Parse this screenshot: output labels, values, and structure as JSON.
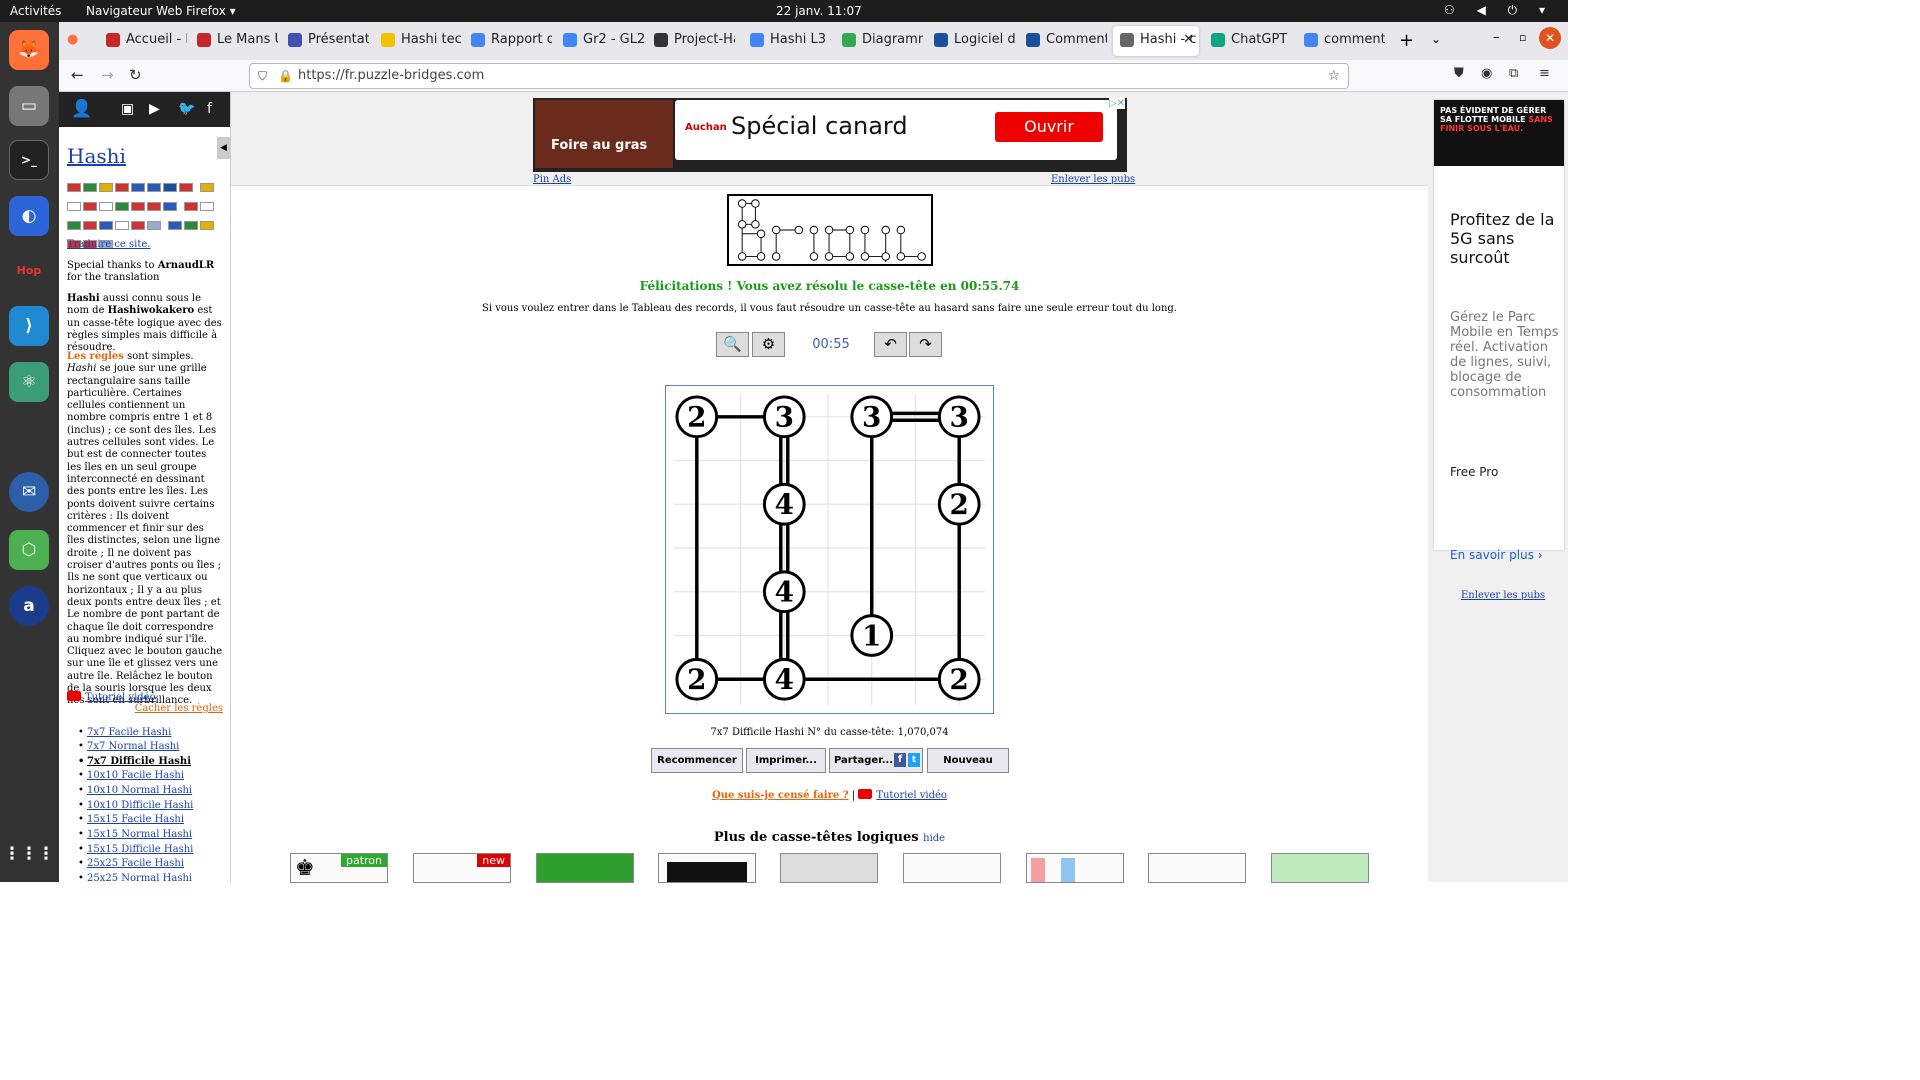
{
  "topbar": {
    "activities": "Activités",
    "app": "Navigateur Web Firefox ▾",
    "clock": "22 janv.  11:07"
  },
  "tabs": [
    {
      "label": "Accueil - E",
      "color": "#c62828"
    },
    {
      "label": "Le Mans U",
      "color": "#c62828"
    },
    {
      "label": "Présentat",
      "color": "#3f51b5"
    },
    {
      "label": "Hashi tech",
      "color": "#f2c200"
    },
    {
      "label": "Rapport d",
      "color": "#4285f4"
    },
    {
      "label": "Gr2 - GL2",
      "color": "#4285f4"
    },
    {
      "label": "Project-Ha",
      "color": "#333333"
    },
    {
      "label": "Hashi L3 -",
      "color": "#4285f4"
    },
    {
      "label": "Diagramm",
      "color": "#34a853"
    },
    {
      "label": "Logiciel de",
      "color": "#1a4fa0"
    },
    {
      "label": "Comment",
      "color": "#1a4fa0"
    },
    {
      "label": "Hashi - c",
      "color": "#666666"
    },
    {
      "label": "ChatGPT",
      "color": "#10a37f"
    },
    {
      "label": "comment",
      "color": "#4285f4"
    }
  ],
  "nav": {
    "url": "https://fr.puzzle-bridges.com"
  },
  "left": {
    "title": "Hashi",
    "translate": "Traduire ce site.",
    "thanks_a": "Special thanks to ",
    "thanks_name": "ArnaudLR",
    "thanks_b": " for the translation",
    "intro_name": "Hashi",
    "intro_a": " aussi connu sous le nom de ",
    "intro_alt": "Hashiwokakero",
    "intro_b": " est un casse-tête logique avec des règles simples mais difficile à résoudre.",
    "rules_label": "Les règles",
    "rules_a": " sont simples. ",
    "rules_name": "Hashi",
    "rules_text": " se joue sur une grille rectangulaire sans taille particulière. Certaines cellules contiennent un nombre compris entre 1 et 8 (inclus) ; ce sont des îles. Les autres cellules sont vides. Le but est de connecter toutes les îles en un seul groupe interconnecté en dessinant des ponts entre les îles. Les ponts doivent suivre certains critères : Ils doivent commencer et finir sur des îles distinctes, selon une ligne droite ; Il ne doivent pas croiser d'autres ponts ou îles ; Ils ne sont que verticaux ou horizontaux ; Il y a au plus deux ponts entre deux îles ; et Le nombre de pont partant de chaque île doit correspondre au nombre indiqué sur l'île.",
    "rules_mouse": "Cliquez avec le bouton gauche sur une île et glissez vers une autre île. Relâchez le bouton de la souris lorsque les deux îles sont en surbrillance.",
    "tutorial": "Tutoriel vidéo",
    "hide_rules": "Cacher les règles",
    "links": [
      "7x7 Facile Hashi",
      "7x7 Normal Hashi",
      "7x7 Difficile Hashi",
      "10x10 Facile Hashi",
      "10x10 Normal Hashi",
      "10x10 Difficile Hashi",
      "15x15 Facile Hashi",
      "15x15 Normal Hashi",
      "15x15 Difficile Hashi",
      "25x25 Facile Hashi",
      "25x25 Normal Hashi"
    ]
  },
  "ad": {
    "img_text": "Foire au gras",
    "brand": "Auchan",
    "headline": "Spécial canard",
    "cta": "Ouvrir",
    "pin": "Pin Ads",
    "remove": "Enlever les pubs"
  },
  "main": {
    "congrats": "Félicitations ! Vous avez résolu le casse-tête en 00:55.74",
    "note": "Si vous voulez entrer dans le Tableau des records, il vous faut résoudre un casse-tête au hasard sans faire une seule erreur tout du long.",
    "timer": "00:55",
    "puzzle_info": "7x7 Difficile Hashi N° du casse-tête: 1,070,074",
    "buttons": [
      "Recommencer",
      "Imprimer...",
      "Partager...",
      "Nouveau"
    ],
    "help_what": "Que suis-je censé faire ?",
    "help_sep": " | ",
    "help_tutorial": "Tutoriel vidéo",
    "more_title": "Plus de casse-têtes logiques",
    "more_hide": "hide",
    "thumb_labels": [
      "patron",
      "new"
    ]
  },
  "hashi": {
    "grid": 7,
    "islands": [
      {
        "r": 0,
        "c": 0,
        "n": "2"
      },
      {
        "r": 0,
        "c": 2,
        "n": "3"
      },
      {
        "r": 0,
        "c": 4,
        "n": "3"
      },
      {
        "r": 0,
        "c": 6,
        "n": "3"
      },
      {
        "r": 2,
        "c": 2,
        "n": "4"
      },
      {
        "r": 2,
        "c": 6,
        "n": "2"
      },
      {
        "r": 4,
        "c": 2,
        "n": "4"
      },
      {
        "r": 5,
        "c": 4,
        "n": "1"
      },
      {
        "r": 6,
        "c": 0,
        "n": "2"
      },
      {
        "r": 6,
        "c": 2,
        "n": "4"
      },
      {
        "r": 6,
        "c": 6,
        "n": "2"
      }
    ],
    "bridges": [
      {
        "a": [
          0,
          0
        ],
        "b": [
          0,
          2
        ],
        "count": 1
      },
      {
        "a": [
          0,
          4
        ],
        "b": [
          0,
          6
        ],
        "count": 2
      },
      {
        "a": [
          0,
          0
        ],
        "b": [
          6,
          0
        ],
        "count": 1
      },
      {
        "a": [
          0,
          2
        ],
        "b": [
          2,
          2
        ],
        "count": 2
      },
      {
        "a": [
          2,
          2
        ],
        "b": [
          4,
          2
        ],
        "count": 2
      },
      {
        "a": [
          4,
          2
        ],
        "b": [
          6,
          2
        ],
        "count": 2
      },
      {
        "a": [
          0,
          4
        ],
        "b": [
          5,
          4
        ],
        "count": 1
      },
      {
        "a": [
          0,
          6
        ],
        "b": [
          2,
          6
        ],
        "count": 1
      },
      {
        "a": [
          2,
          6
        ],
        "b": [
          6,
          6
        ],
        "count": 1
      },
      {
        "a": [
          6,
          0
        ],
        "b": [
          6,
          2
        ],
        "count": 1
      },
      {
        "a": [
          6,
          2
        ],
        "b": [
          6,
          6
        ],
        "count": 1
      }
    ]
  },
  "right_ad": {
    "top_a": "PAS ÉVIDENT DE GÉRER SA FLOTTE MOBILE",
    "top_b": "SANS FINIR SOUS L'EAU.",
    "headline": "Profitez de la 5G sans surcoût",
    "body": "Gérez le Parc Mobile en Temps réel. Activation de lignes, suivi, blocage de consommation",
    "brand": "Free Pro",
    "cta": "En savoir plus  ›",
    "remove": "Enlever les pubs"
  }
}
